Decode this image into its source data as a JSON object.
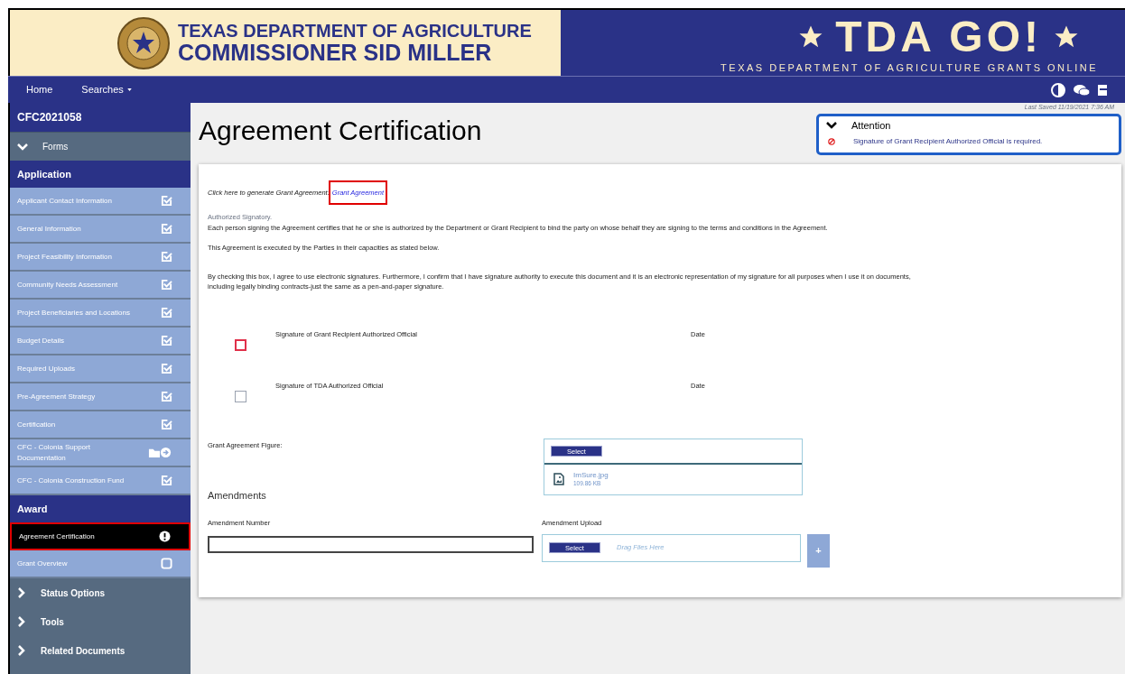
{
  "header": {
    "agency_line1": "TEXAS DEPARTMENT OF AGRICULTURE",
    "agency_line2": "COMMISSIONER SID MILLER",
    "brand": "TDA GO!",
    "brand_subtitle": "TEXAS DEPARTMENT OF AGRICULTURE GRANTS ONLINE"
  },
  "nav": [
    {
      "label": "Home",
      "dropdown": false
    },
    {
      "label": "Searches",
      "dropdown": true
    }
  ],
  "sidebar": {
    "record_id": "CFC2021058",
    "forms_label": "Forms",
    "forms_expanded": true,
    "sections": [
      {
        "title": "Application",
        "items": [
          {
            "label": "Applicant Contact Information",
            "kind": "complete",
            "selected": false
          },
          {
            "label": "General Information",
            "kind": "complete",
            "selected": false
          },
          {
            "label": "Project Feasibility Information",
            "kind": "complete",
            "selected": false
          },
          {
            "label": "Community Needs Assessment",
            "kind": "complete",
            "selected": false
          },
          {
            "label": "Project Beneficiaries and Locations",
            "kind": "complete",
            "selected": false
          },
          {
            "label": "Budget Details",
            "kind": "complete",
            "selected": false
          },
          {
            "label": "Required Uploads",
            "kind": "complete",
            "selected": false
          },
          {
            "label": "Pre-Agreement Strategy",
            "kind": "complete",
            "selected": false
          },
          {
            "label": "Certification",
            "kind": "complete",
            "selected": false
          },
          {
            "label": "CFC - Colonia Support Documentation",
            "kind": "folder",
            "selected": false
          },
          {
            "label": "CFC - Colonia Construction Fund",
            "kind": "complete",
            "selected": false
          }
        ]
      },
      {
        "title": "Award",
        "items": [
          {
            "label": "Agreement Certification",
            "kind": "error",
            "selected": true
          },
          {
            "label": "Grant Overview",
            "kind": "empty",
            "selected": false
          }
        ]
      }
    ],
    "menus": [
      {
        "label": "Status Options",
        "expanded": false
      },
      {
        "label": "Tools",
        "expanded": false
      },
      {
        "label": "Related Documents",
        "expanded": false
      }
    ]
  },
  "page": {
    "title": "Agreement Certification",
    "last_saved": "Last Saved 11/19/2021 7:36 AM"
  },
  "attention": {
    "title": "Attention",
    "expanded": true,
    "messages": [
      "Signature of Grant Recipient Authorized Official is required."
    ]
  },
  "form": {
    "generate_prompt": "Click here to generate Grant Agreement:",
    "generate_link": "Grant Agreement",
    "signatory_heading": "Authorized Signatory.",
    "signatory_text": "Each person signing the Agreement certifies that he or she is authorized by the Department or Grant Recipient to bind the party on whose behalf they are signing to the terms and conditions in the Agreement.",
    "executed_text": "This Agreement is executed by the Parties in their capacities as stated below.",
    "consent_text": "By checking this box, I agree to use electronic signatures. Furthermore, I confirm that I have signature authority to execute this document and it is an electronic representation of my signature for all purposes when I use it on documents, including legally binding contracts-just the same as a pen-and-paper signature.",
    "signatures": [
      {
        "label": "Signature of Grant Recipient Authorized Official",
        "date_label": "Date",
        "checked": false,
        "invalid": true
      },
      {
        "label": "Signature of TDA Authorized Official",
        "date_label": "Date",
        "checked": false,
        "invalid": false
      }
    ],
    "figure_label": "Grant Agreement Figure:",
    "figure_select": "Select",
    "figure_file": {
      "name": "ImSure.jpg",
      "size": "109.86 KB"
    },
    "amendments_heading": "Amendments",
    "amendment_number_label": "Amendment Number",
    "amendment_upload_label": "Amendment Upload",
    "amendment_select": "Select",
    "amendment_drop_hint": "Drag Files Here",
    "add_button": "+"
  }
}
